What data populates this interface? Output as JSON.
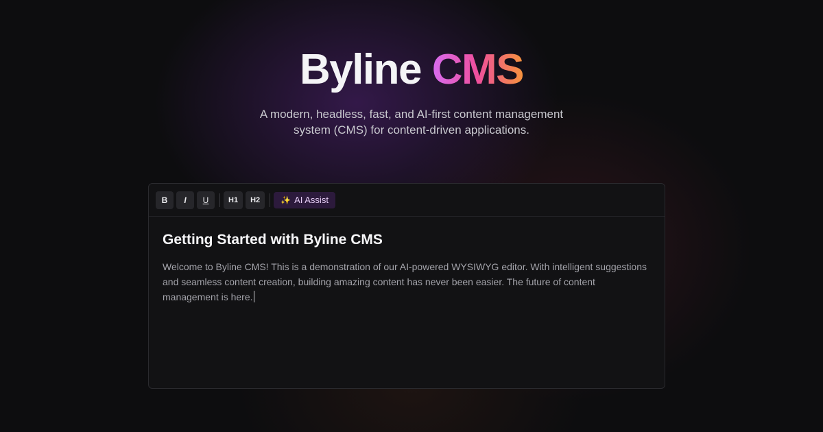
{
  "hero": {
    "title_plain": "Byline",
    "title_accent": "CMS",
    "subtitle": "A modern, headless, fast, and AI-first content management system (CMS) for content-driven applications."
  },
  "toolbar": {
    "bold_label": "B",
    "italic_label": "I",
    "underline_label": "U",
    "h1_label": "H1",
    "h2_label": "H2",
    "ai_assist_label": "AI Assist",
    "ai_assist_icon": "sparkles-icon"
  },
  "document": {
    "title": "Getting Started with Byline CMS",
    "body": "Welcome to Byline CMS! This is a demonstration of our AI-powered WYSIWYG editor. With intelligent suggestions and seamless content creation, building amazing content has never been easier. The future of content management is here."
  },
  "colors": {
    "background": "#0d0d0f",
    "editor_background": "#121214",
    "accent_gradient_start": "#d76cf0",
    "accent_gradient_mid": "#ee4f9c",
    "accent_gradient_end": "#f6933c",
    "ai_button_background": "#2c1a3c"
  }
}
